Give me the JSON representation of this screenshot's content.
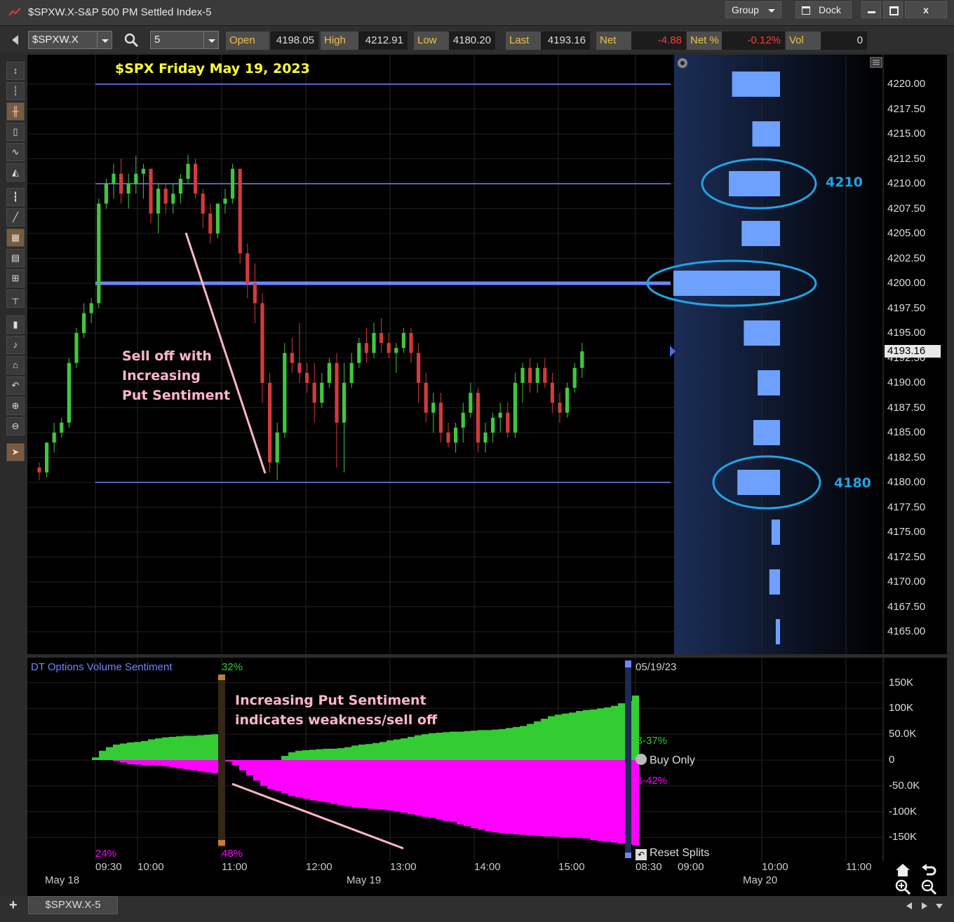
{
  "window": {
    "title": "$SPXW.X-S&P 500 PM Settled Index-5",
    "group_label": "Group",
    "dock_label": "Dock",
    "minimize_icon": "minimize-icon",
    "maximize_icon": "maximize-icon",
    "close_label": "x"
  },
  "toolbar": {
    "symbol": "$SPXW.X",
    "interval": "5",
    "quote": [
      {
        "label": "Open",
        "value": "4198.05"
      },
      {
        "label": "High",
        "value": "4212.91"
      },
      {
        "label": "Low",
        "value": "4180.20"
      },
      {
        "label": "Last",
        "value": "4193.16"
      },
      {
        "label": "Net",
        "value": "-4.88"
      },
      {
        "label": "Net %",
        "value": "-0.12%"
      },
      {
        "label": "Vol",
        "value": "0"
      }
    ],
    "negative_color": "#ff3b3b"
  },
  "chart": {
    "annotation_title": "$SPX Friday May 19, 2023",
    "annotation_selloff": [
      "Sell off with",
      "Increasing",
      "Put Sentiment"
    ],
    "level_high_label": "4210",
    "level_low_label": "4180",
    "last_price_tag": "4193.16",
    "price_axis": [
      "4220.00",
      "4217.50",
      "4215.00",
      "4212.50",
      "4210.00",
      "4207.50",
      "4205.00",
      "4202.50",
      "4200.00",
      "4197.50",
      "4195.00",
      "4192.50",
      "4190.00",
      "4187.50",
      "4185.00",
      "4182.50",
      "4180.00",
      "4177.50",
      "4175.00",
      "4172.50",
      "4170.00",
      "4167.50",
      "4165.00"
    ],
    "colors": {
      "up": "#3ec83e",
      "down": "#d43a3a",
      "level": "#6f86ff",
      "annotation_yellow": "#ffff33",
      "annotation_pink": "#ffb6c8",
      "circle": "#1fa4e6",
      "profile": "#6ea0ff"
    }
  },
  "chart_data": {
    "type": "candlestick",
    "xlabel": "",
    "ylabel": "",
    "ylim": [
      4163,
      4222.5
    ],
    "horizontal_levels": [
      4220,
      4210,
      4200,
      4180
    ],
    "volume_profile_levels": [
      4220,
      4215,
      4210,
      4205,
      4200,
      4195,
      4190,
      4185,
      4180,
      4175,
      4170,
      4165
    ],
    "volume_profile_relative": [
      0.45,
      0.26,
      0.48,
      0.36,
      1.0,
      0.34,
      0.21,
      0.25,
      0.4,
      0.08,
      0.1,
      0.04
    ],
    "candles_ohlc": [
      [
        4181.5,
        4182,
        4180.2,
        4181
      ],
      [
        4181,
        4184,
        4180.5,
        4184
      ],
      [
        4184,
        4186,
        4183,
        4185
      ],
      [
        4185,
        4186.5,
        4184.5,
        4186
      ],
      [
        4186,
        4192.5,
        4185.5,
        4192
      ],
      [
        4192,
        4195.5,
        4191.5,
        4195
      ],
      [
        4195,
        4198,
        4194.5,
        4197
      ],
      [
        4197,
        4198.5,
        4196,
        4198
      ],
      [
        4198,
        4208.5,
        4197.5,
        4208
      ],
      [
        4208,
        4210.5,
        4207.5,
        4210
      ],
      [
        4210,
        4212,
        4208.5,
        4211
      ],
      [
        4211,
        4212.5,
        4208,
        4209
      ],
      [
        4209,
        4211,
        4207.5,
        4210
      ],
      [
        4210,
        4212.8,
        4209,
        4211
      ],
      [
        4211,
        4212,
        4208.5,
        4211.5
      ],
      [
        4211.5,
        4211.5,
        4206,
        4207
      ],
      [
        4207,
        4210,
        4205,
        4209.5
      ],
      [
        4209.5,
        4210,
        4207,
        4208
      ],
      [
        4208,
        4210,
        4207,
        4209
      ],
      [
        4209,
        4211,
        4208,
        4210.5
      ],
      [
        4210.5,
        4212.91,
        4210,
        4212
      ],
      [
        4212,
        4212.5,
        4208.5,
        4209
      ],
      [
        4209,
        4209.5,
        4205.5,
        4207
      ],
      [
        4207,
        4208,
        4204,
        4205
      ],
      [
        4205,
        4208,
        4204.5,
        4208
      ],
      [
        4208,
        4209.5,
        4207,
        4208.5
      ],
      [
        4208.5,
        4212,
        4208,
        4211.5
      ],
      [
        4211.5,
        4211.5,
        4202,
        4203
      ],
      [
        4203,
        4204,
        4198.5,
        4200
      ],
      [
        4200,
        4202,
        4196,
        4198
      ],
      [
        4198,
        4199,
        4188,
        4190
      ],
      [
        4190,
        4191,
        4181,
        4182
      ],
      [
        4182,
        4186,
        4180.2,
        4185
      ],
      [
        4185,
        4194,
        4184.5,
        4193
      ],
      [
        4193,
        4194.5,
        4191,
        4192
      ],
      [
        4192,
        4196,
        4190,
        4191
      ],
      [
        4191,
        4192,
        4189,
        4190
      ],
      [
        4190,
        4192,
        4186,
        4188
      ],
      [
        4188,
        4191,
        4187.5,
        4190
      ],
      [
        4190,
        4192.5,
        4189.5,
        4192
      ],
      [
        4192,
        4193,
        4181.5,
        4186
      ],
      [
        4186,
        4192,
        4181,
        4190
      ],
      [
        4190,
        4193,
        4189.5,
        4192
      ],
      [
        4192,
        4194.5,
        4191.5,
        4194
      ],
      [
        4194,
        4195.5,
        4192,
        4193
      ],
      [
        4193,
        4196,
        4192.5,
        4195
      ],
      [
        4195,
        4196.5,
        4193,
        4194
      ],
      [
        4194,
        4195,
        4192.5,
        4193
      ],
      [
        4193,
        4194,
        4191,
        4193.5
      ],
      [
        4193.5,
        4195.5,
        4193,
        4195
      ],
      [
        4195,
        4195.5,
        4192,
        4193
      ],
      [
        4193,
        4194,
        4188,
        4190
      ],
      [
        4190,
        4191,
        4186,
        4187
      ],
      [
        4187,
        4189,
        4185,
        4188
      ],
      [
        4188,
        4189,
        4184,
        4185
      ],
      [
        4185,
        4186,
        4183.5,
        4184
      ],
      [
        4184,
        4186,
        4183,
        4185.5
      ],
      [
        4185.5,
        4188,
        4184,
        4187
      ],
      [
        4187,
        4190,
        4186.5,
        4189
      ],
      [
        4189,
        4189.5,
        4183,
        4184
      ],
      [
        4184,
        4186,
        4183,
        4185
      ],
      [
        4185,
        4187,
        4184,
        4186.5
      ],
      [
        4186.5,
        4188,
        4185,
        4187
      ],
      [
        4187,
        4188,
        4184.5,
        4185
      ],
      [
        4185,
        4191,
        4184.5,
        4190
      ],
      [
        4190,
        4192,
        4188,
        4191.5
      ],
      [
        4191.5,
        4192.5,
        4189,
        4190
      ],
      [
        4190,
        4192,
        4189,
        4191.5
      ],
      [
        4191.5,
        4192.5,
        4189.5,
        4190
      ],
      [
        4190,
        4191,
        4187,
        4188
      ],
      [
        4188,
        4189,
        4186,
        4187
      ],
      [
        4187,
        4190,
        4186.5,
        4189.5
      ],
      [
        4189.5,
        4192,
        4189,
        4191.5
      ],
      [
        4191.5,
        4194,
        4190.5,
        4193.16
      ]
    ]
  },
  "indicator": {
    "title": "DT Options Volume Sentiment",
    "marker_top_pct": "32%",
    "marker_bottom_pct": "48%",
    "left_bottom_pct": "24%",
    "date_label": "05/19/23",
    "call_label": "B-37%",
    "put_label": "B-42%",
    "buy_only_label": "Buy Only",
    "reset_splits_label": "Reset Splits",
    "annotation": [
      "Increasing Put Sentiment",
      "indicates weakness/sell off"
    ],
    "axis": [
      "150K",
      "100K",
      "50.0K",
      "0",
      "-50.0K",
      "-100K",
      "-150K"
    ],
    "colors": {
      "call": "#33cc33",
      "put": "#ff00ff",
      "title": "#6f86ff"
    }
  },
  "indicator_data": {
    "ylim": [
      -190000,
      190000
    ],
    "calls": [
      5000,
      18000,
      25000,
      30000,
      32000,
      34000,
      35000,
      37000,
      40000,
      42000,
      44000,
      45000,
      46000,
      47000,
      47000,
      48000,
      49000,
      50000,
      0,
      0,
      0,
      0,
      0,
      0,
      0,
      0,
      0,
      8000,
      15000,
      18000,
      19000,
      20000,
      21000,
      22000,
      22000,
      23000,
      25000,
      28000,
      30000,
      31000,
      33000,
      35000,
      38000,
      40000,
      42000,
      45000,
      48000,
      50000,
      52000,
      53000,
      54000,
      55000,
      55000,
      56000,
      57000,
      58000,
      58000,
      59000,
      60000,
      62000,
      64000,
      66000,
      70000,
      75000,
      80000,
      85000,
      88000,
      90000,
      92000,
      95000,
      97000,
      98000,
      100000,
      102000,
      105000,
      110000,
      115000,
      125000
    ],
    "puts": [
      0,
      0,
      0,
      -2000,
      -5000,
      -8000,
      -9000,
      -10000,
      -10000,
      -11000,
      -12000,
      -14000,
      -16000,
      -18000,
      -20000,
      -22000,
      -24000,
      -26000,
      0,
      -3000,
      -10000,
      -20000,
      -30000,
      -40000,
      -50000,
      -56000,
      -60000,
      -65000,
      -70000,
      -72000,
      -75000,
      -78000,
      -80000,
      -82000,
      -85000,
      -88000,
      -90000,
      -92000,
      -93000,
      -94000,
      -95000,
      -96000,
      -98000,
      -100000,
      -102000,
      -105000,
      -107000,
      -110000,
      -112000,
      -115000,
      -118000,
      -120000,
      -125000,
      -128000,
      -132000,
      -135000,
      -138000,
      -140000,
      -142000,
      -143000,
      -144000,
      -145000,
      -146000,
      -147000,
      -148000,
      -148000,
      -149000,
      -150000,
      -150000,
      -151000,
      -152000,
      -155000,
      -157000,
      -158000,
      -160000,
      -162000,
      -163000,
      -165000
    ]
  },
  "time_axis": {
    "ticks": [
      "09:30",
      "10:00",
      "11:00",
      "12:00",
      "13:00",
      "14:00",
      "15:00",
      "08:30",
      "09:00",
      "10:00",
      "11:00"
    ],
    "dates": [
      "May 18",
      "May 19",
      "May 20"
    ]
  },
  "bottom": {
    "tab_label": "$SPXW.X-5",
    "add_label": "+"
  }
}
